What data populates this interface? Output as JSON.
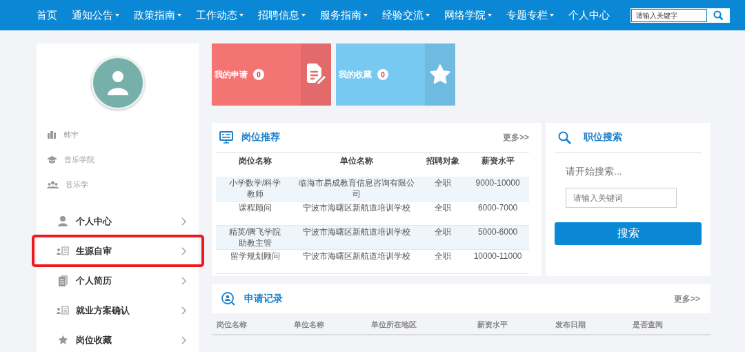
{
  "nav": {
    "items": [
      {
        "label": "首页",
        "dropdown": false
      },
      {
        "label": "通知公告",
        "dropdown": true
      },
      {
        "label": "政策指南",
        "dropdown": true
      },
      {
        "label": "工作动态",
        "dropdown": true
      },
      {
        "label": "招聘信息",
        "dropdown": true
      },
      {
        "label": "服务指南",
        "dropdown": true
      },
      {
        "label": "经验交流",
        "dropdown": true
      },
      {
        "label": "网络学院",
        "dropdown": true
      },
      {
        "label": "专题专栏",
        "dropdown": true
      },
      {
        "label": "个人中心",
        "dropdown": false
      }
    ],
    "search": {
      "placeholder": "请输入关键字"
    }
  },
  "profile": {
    "info": [
      {
        "kind": "name",
        "text": "韩宇"
      },
      {
        "kind": "school",
        "text": "音乐学院"
      },
      {
        "kind": "major",
        "text": "音乐学"
      }
    ]
  },
  "menu": [
    {
      "kind": "person",
      "label": "个人中心",
      "highlighted": false
    },
    {
      "kind": "card",
      "label": "生源自审",
      "highlighted": true
    },
    {
      "kind": "document",
      "label": "个人简历",
      "highlighted": false
    },
    {
      "kind": "card",
      "label": "就业方案确认",
      "highlighted": false
    },
    {
      "kind": "star",
      "label": "岗位收藏",
      "highlighted": false
    }
  ],
  "tiles": [
    {
      "kind": "apply",
      "label": "我的申请",
      "count": "0",
      "color": "#f47373"
    },
    {
      "kind": "favorite",
      "label": "我的收藏",
      "count": "0",
      "color": "#77c9f1"
    }
  ],
  "recommend": {
    "title": "岗位推荐",
    "more": "更多>>",
    "columns": [
      "岗位名称",
      "单位名称",
      "招聘对象",
      "薪资水平"
    ],
    "rows": [
      [
        "小学数学/科学教师",
        "临海市易成教育信息咨询有限公司",
        "全职",
        "9000-10000"
      ],
      [
        "课程顾问",
        "宁波市海曙区新航道培训学校",
        "全职",
        "6000-7000"
      ],
      [
        "精英/腾飞学院助教主管",
        "宁波市海曙区新航道培训学校",
        "全职",
        "5000-6000"
      ],
      [
        "留学规划顾问",
        "宁波市海曙区新航道培训学校",
        "全职",
        "10000-11000"
      ]
    ]
  },
  "job_search": {
    "title": "职位搜索",
    "hint": "请开始搜索...",
    "placeholder": "请输入关键词",
    "button": "搜索"
  },
  "records": {
    "title": "申请记录",
    "more": "更多>>",
    "columns": [
      "岗位名称",
      "单位名称",
      "单位所在地区",
      "薪资水平",
      "发布日期",
      "是否查阅"
    ]
  }
}
